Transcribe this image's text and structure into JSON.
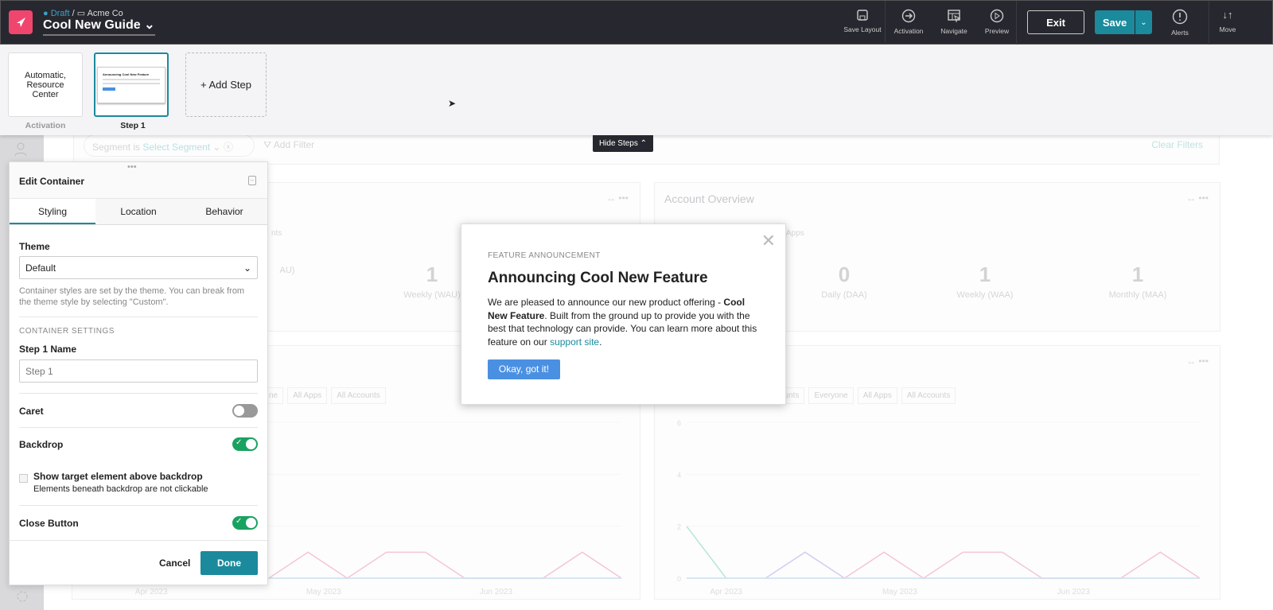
{
  "header": {
    "status": "Draft",
    "app": "Acme Co",
    "guide_title": "Cool New Guide",
    "tools": [
      {
        "label": "Save Layout",
        "icon": "save-icon"
      },
      {
        "label": "Activation",
        "icon": "arrow-circle-icon"
      },
      {
        "label": "Navigate",
        "icon": "navigate-icon"
      },
      {
        "label": "Preview",
        "icon": "play-icon"
      }
    ],
    "exit": "Exit",
    "save": "Save",
    "alerts": "Alerts",
    "move": "Move"
  },
  "steps": {
    "items": [
      {
        "content": "Automatic, Resource Center",
        "label": "Activation"
      },
      {
        "label": "Step 1"
      }
    ],
    "add": "+ Add Step",
    "hide": "Hide Steps"
  },
  "dashboard": {
    "segment_label": "Segment is",
    "segment_value": "Select Segment",
    "add_filter": "Add Filter",
    "clear_filters": "Clear Filters",
    "left_card": {
      "partial_label": "nts",
      "metrics": [
        {
          "value": "",
          "label": "AU)"
        },
        {
          "value": "1",
          "label": "Weekly (WAU)"
        }
      ],
      "chips": [
        "ne",
        "All Apps",
        "All Accounts"
      ]
    },
    "right_card": {
      "title": "Account Overview",
      "partial_label": "Apps",
      "metrics": [
        {
          "value": "0",
          "label": "Daily (DAA)"
        },
        {
          "value": "1",
          "label": "Weekly (WAA)"
        },
        {
          "value": "1",
          "label": "Monthly (MAA)"
        }
      ],
      "chips": [
        "ccounts",
        "Everyone",
        "All Apps",
        "All Accounts"
      ]
    }
  },
  "chart_data": [
    {
      "type": "line",
      "x_ticks": [
        "Apr 2023",
        "May 2023",
        "Jun 2023"
      ],
      "ylim": [
        0,
        6
      ],
      "y_ticks": [],
      "series": [
        {
          "color": "#f5c6d3",
          "values": [
            0,
            0,
            0,
            0,
            0,
            1,
            0,
            1,
            1,
            0,
            0,
            0,
            1,
            0
          ]
        },
        {
          "color": "#c9dff0",
          "values": [
            0,
            0,
            0,
            0,
            0,
            0,
            0,
            0,
            0,
            0,
            0,
            0,
            0,
            0
          ]
        }
      ]
    },
    {
      "type": "line",
      "x_ticks": [
        "Apr 2023",
        "May 2023",
        "Jun 2023"
      ],
      "ylim": [
        0,
        6
      ],
      "y_ticks": [
        "0",
        "2",
        "4",
        "6"
      ],
      "series": [
        {
          "color": "#b6e6d6",
          "values": [
            2,
            0,
            null,
            null,
            null,
            null,
            null,
            null,
            null,
            null,
            null,
            null,
            null,
            null
          ]
        },
        {
          "color": "#d3ccf3",
          "values": [
            null,
            null,
            0,
            1,
            0,
            null,
            null,
            null,
            null,
            null,
            null,
            null,
            null,
            null
          ]
        },
        {
          "color": "#f5c6d3",
          "values": [
            null,
            null,
            null,
            null,
            0,
            1,
            0,
            1,
            1,
            0,
            0,
            0,
            1,
            0
          ]
        },
        {
          "color": "#c9dff0",
          "values": [
            0,
            0,
            0,
            0,
            0,
            0,
            0,
            0,
            0,
            0,
            0,
            0,
            0,
            0
          ]
        }
      ]
    }
  ],
  "panel": {
    "title": "Edit Container",
    "tabs": [
      "Styling",
      "Location",
      "Behavior"
    ],
    "theme_label": "Theme",
    "theme_value": "Default",
    "theme_help": "Container styles are set by the theme. You can break from the theme style by selecting \"Custom\".",
    "section": "CONTAINER SETTINGS",
    "name_label": "Step 1 Name",
    "name_value": "Step 1",
    "caret": "Caret",
    "caret_on": false,
    "backdrop": "Backdrop",
    "backdrop_on": true,
    "show_target": "Show target element above backdrop",
    "show_target_help": "Elements beneath backdrop are not clickable",
    "close_button": "Close Button",
    "close_on": true,
    "cancel": "Cancel",
    "done": "Done"
  },
  "modal": {
    "eyebrow": "FEATURE ANNOUNCEMENT",
    "title": "Announcing Cool New Feature",
    "body_1": "We are pleased to announce our new product offering - ",
    "body_bold": "Cool New Feature",
    "body_2": ". Built from the ground up to provide you with the best that technology can provide. You can learn more about this feature on our ",
    "link": "support site",
    "body_3": ".",
    "button": "Okay, got it!"
  },
  "colors": {
    "accent": "#1b8a9c",
    "brand": "#f0466e",
    "toggle_on": "#1aa260",
    "cta": "#4a90e2"
  }
}
